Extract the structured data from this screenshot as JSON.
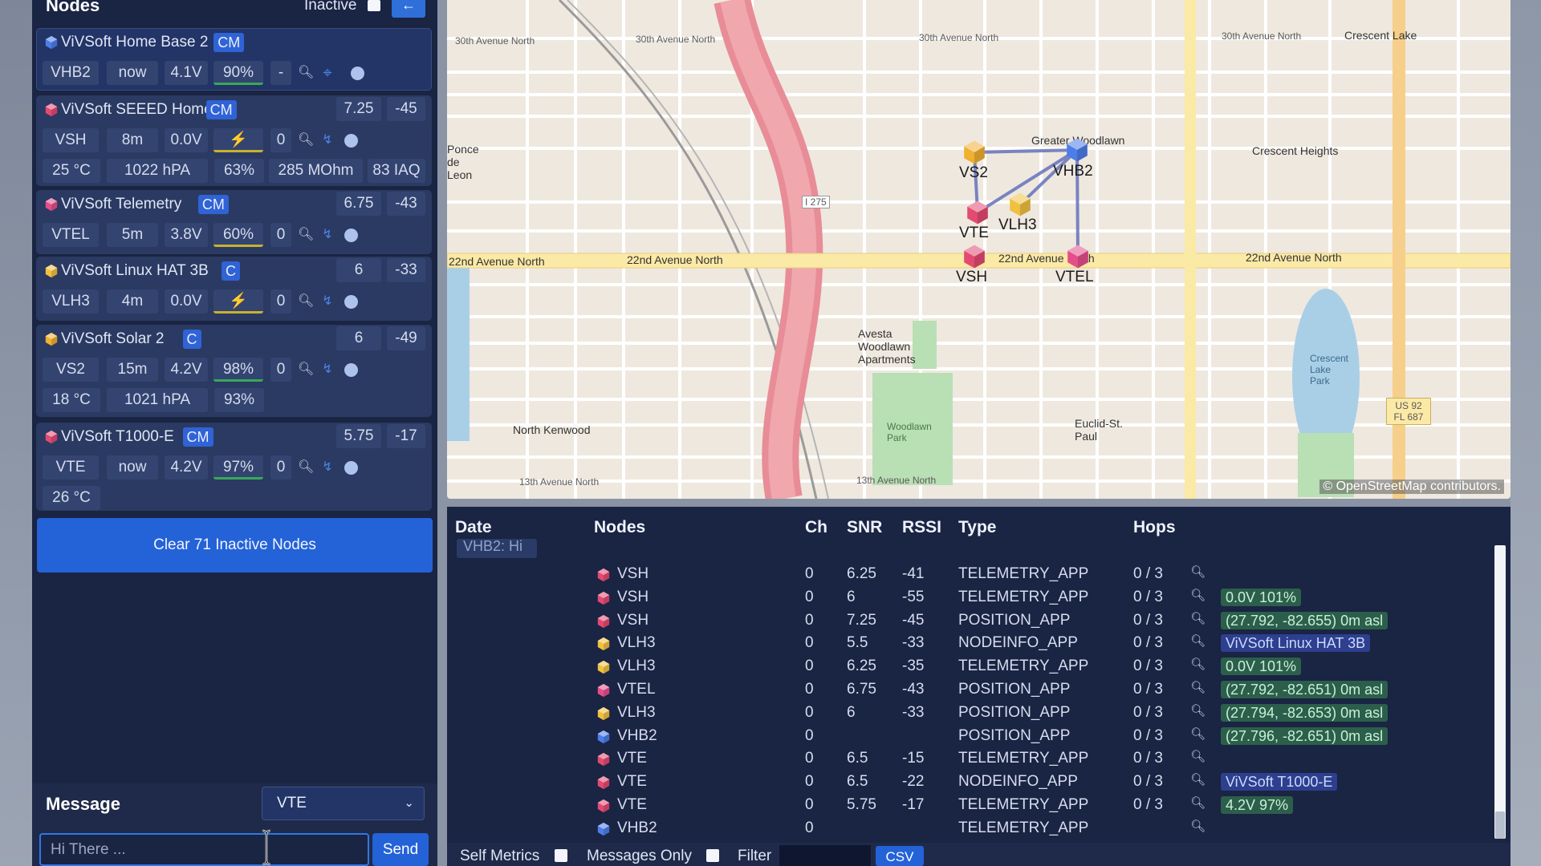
{
  "nodes_panel": {
    "title": "Nodes",
    "inactive_label": "Inactive",
    "back_icon": "←",
    "clear_button": "Clear 71 Inactive Nodes"
  },
  "node_cards": [
    {
      "name": "ViVSoft Home Base 2",
      "badge": "CM",
      "icon_color": "#4d7de8",
      "stats": [
        "VHB2",
        "now",
        "4.1V",
        "90%",
        "-"
      ]
    },
    {
      "name": "ViVSoft SEEED Home",
      "badge": "CM",
      "icon_color": "#e24a72",
      "snr": "7.25",
      "rssi": "-45",
      "stats": [
        "VSH",
        "8m",
        "0.0V",
        "⚡",
        "0"
      ],
      "env": [
        "25 °C",
        "1022 hPA",
        "63%",
        "285 MOhm",
        "83 IAQ"
      ]
    },
    {
      "name": "ViVSoft Telemetry",
      "badge": "CM",
      "icon_color": "#e44f8a",
      "snr": "6.75",
      "rssi": "-43",
      "stats": [
        "VTEL",
        "5m",
        "3.8V",
        "60%",
        "0"
      ]
    },
    {
      "name": "ViVSoft Linux HAT 3B",
      "badge": "C",
      "icon_color": "#f0c040",
      "snr": "6",
      "rssi": "-33",
      "stats": [
        "VLH3",
        "4m",
        "0.0V",
        "⚡",
        "0"
      ]
    },
    {
      "name": "ViVSoft Solar 2",
      "badge": "C",
      "icon_color": "#f0b030",
      "snr": "6",
      "rssi": "-49",
      "stats": [
        "VS2",
        "15m",
        "4.2V",
        "98%",
        "0"
      ],
      "env": [
        "18 °C",
        "1021 hPA",
        "93%"
      ]
    },
    {
      "name": "ViVSoft T1000-E",
      "badge": "CM",
      "icon_color": "#e24a72",
      "snr": "5.75",
      "rssi": "-17",
      "stats": [
        "VTE",
        "now",
        "4.2V",
        "97%",
        "0"
      ],
      "env": [
        "26 °C"
      ]
    }
  ],
  "message": {
    "label": "Message",
    "selected_target": "VTE",
    "input_placeholder": "Hi There ...",
    "send_label": "Send"
  },
  "map": {
    "attribution": "© OpenStreetMap contributors.",
    "streets": [
      "30th Avenue North",
      "30th Avenue North",
      "30th Avenue North",
      "30th Avenue North",
      "Crescent Lake",
      "22nd Avenue North",
      "22nd Avenue North",
      "22nd Avenue North",
      "22nd Avenue North",
      "Crescent Heights",
      "Greater Woodlawn",
      "Avesta Woodlawn Apartments",
      "Woodlawn Park",
      "North Kenwood",
      "Euclid-St. Paul",
      "Crescent Lake Park",
      "13th Avenue North",
      "13th Avenue North",
      "Ponce de Leon",
      "I 275",
      "US 92 FL 687"
    ],
    "node_tags": [
      "VS2",
      "VHB2",
      "VTE",
      "VLH3",
      "VSH",
      "VTEL"
    ]
  },
  "packets": {
    "headers": {
      "date": "Date",
      "nodes": "Nodes",
      "ch": "Ch",
      "snr": "SNR",
      "rssi": "RSSI",
      "type": "Type",
      "hops": "Hops"
    },
    "banner": "VHB2: Hi",
    "rows": [
      {
        "node": "VSH",
        "color": "#e24a72",
        "ch": "0",
        "snr": "6.25",
        "rssi": "-41",
        "type": "TELEMETRY_APP",
        "hops": "0 / 3",
        "extra": ""
      },
      {
        "node": "VSH",
        "color": "#e24a72",
        "ch": "0",
        "snr": "6",
        "rssi": "-55",
        "type": "TELEMETRY_APP",
        "hops": "0 / 3",
        "extra": "0.0V 101%"
      },
      {
        "node": "VSH",
        "color": "#e24a72",
        "ch": "0",
        "snr": "7.25",
        "rssi": "-45",
        "type": "POSITION_APP",
        "hops": "0 / 3",
        "extra": "(27.792, -82.655) 0m asl"
      },
      {
        "node": "VLH3",
        "color": "#f0c040",
        "ch": "0",
        "snr": "5.5",
        "rssi": "-33",
        "type": "NODEINFO_APP",
        "hops": "0 / 3",
        "extra": "ViVSoft Linux HAT 3B",
        "extra_blue": true
      },
      {
        "node": "VLH3",
        "color": "#f0c040",
        "ch": "0",
        "snr": "6.25",
        "rssi": "-35",
        "type": "TELEMETRY_APP",
        "hops": "0 / 3",
        "extra": "0.0V 101%"
      },
      {
        "node": "VTEL",
        "color": "#e44f8a",
        "ch": "0",
        "snr": "6.75",
        "rssi": "-43",
        "type": "POSITION_APP",
        "hops": "0 / 3",
        "extra": "(27.792, -82.651) 0m asl"
      },
      {
        "node": "VLH3",
        "color": "#f0c040",
        "ch": "0",
        "snr": "6",
        "rssi": "-33",
        "type": "POSITION_APP",
        "hops": "0 / 3",
        "extra": "(27.794, -82.653) 0m asl"
      },
      {
        "node": "VHB2",
        "color": "#4d7de8",
        "ch": "0",
        "snr": "",
        "rssi": "",
        "type": "POSITION_APP",
        "hops": "0 / 3",
        "extra": "(27.796, -82.651) 0m asl"
      },
      {
        "node": "VTE",
        "color": "#e24a72",
        "ch": "0",
        "snr": "6.5",
        "rssi": "-15",
        "type": "TELEMETRY_APP",
        "hops": "0 / 3",
        "extra": ""
      },
      {
        "node": "VTE",
        "color": "#e24a72",
        "ch": "0",
        "snr": "6.5",
        "rssi": "-22",
        "type": "NODEINFO_APP",
        "hops": "0 / 3",
        "extra": "ViVSoft T1000-E",
        "extra_blue": true
      },
      {
        "node": "VTE",
        "color": "#e24a72",
        "ch": "0",
        "snr": "5.75",
        "rssi": "-17",
        "type": "TELEMETRY_APP",
        "hops": "0 / 3",
        "extra": "4.2V 97%"
      },
      {
        "node": "VHB2",
        "color": "#4d7de8",
        "ch": "0",
        "snr": "",
        "rssi": "",
        "type": "TELEMETRY_APP",
        "hops": "",
        "extra": ""
      }
    ]
  },
  "bottom_bar": {
    "self_metrics": "Self Metrics",
    "messages_only": "Messages Only",
    "filter": "Filter",
    "csv": "CSV"
  },
  "colors": {
    "accent": "#2462d8",
    "panel": "#1a2443",
    "card": "#2b3a62"
  }
}
